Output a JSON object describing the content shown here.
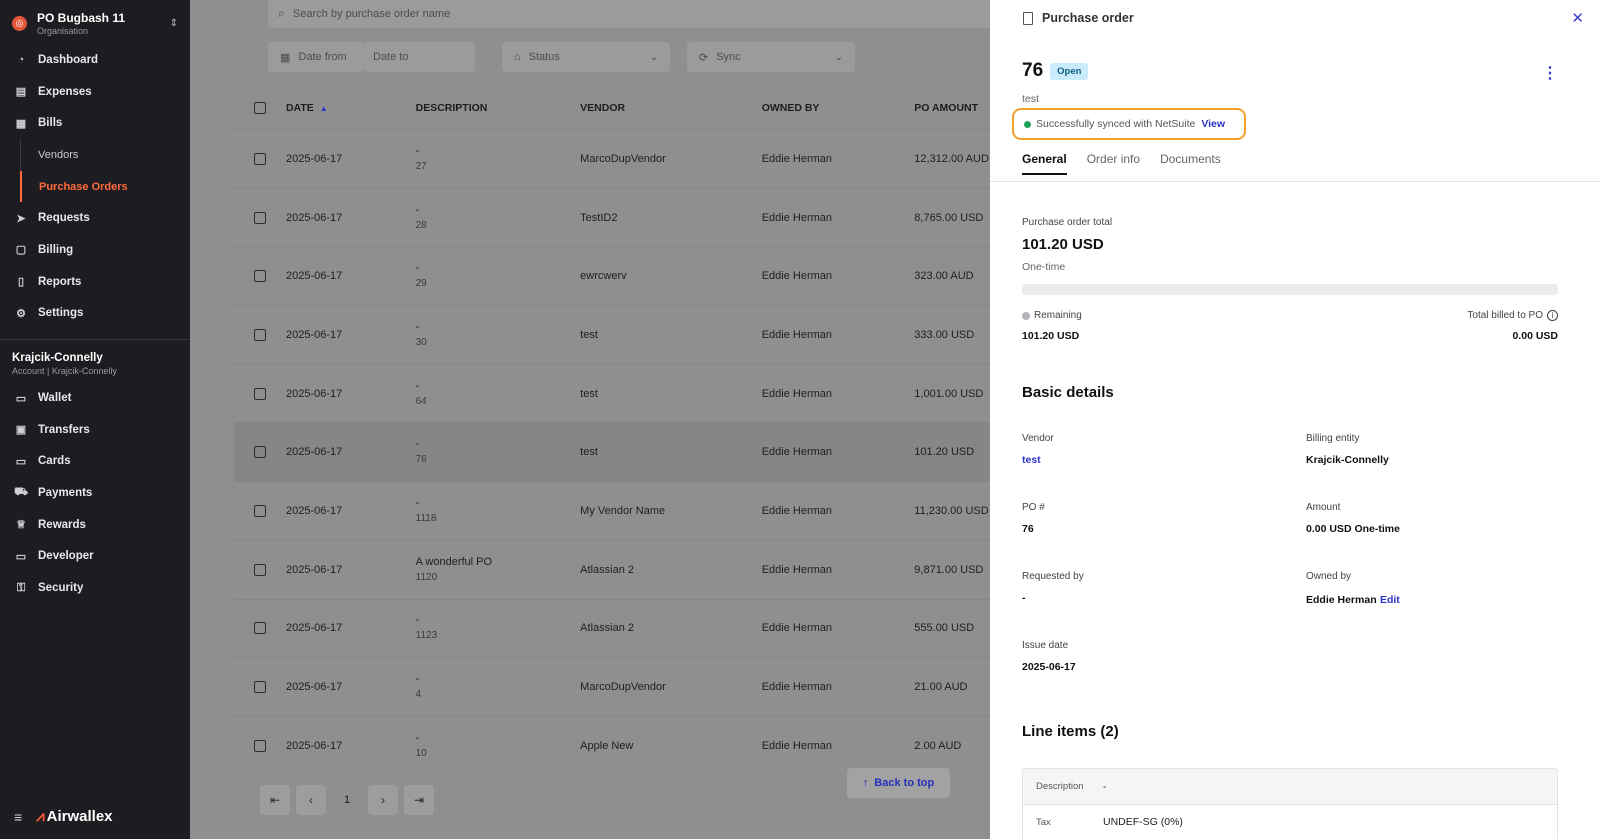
{
  "sidebar": {
    "org": {
      "name": "PO Bugbash 11",
      "sub": "Organisation"
    },
    "items": [
      {
        "label": "Dashboard",
        "icon": "dashboard-icon",
        "glyph": "◔"
      },
      {
        "label": "Expenses",
        "icon": "receipt-icon",
        "glyph": "▤"
      },
      {
        "label": "Bills",
        "icon": "bills-icon",
        "glyph": "▦"
      }
    ],
    "subitems": [
      {
        "label": "Vendors"
      },
      {
        "label": "Purchase Orders",
        "active": true
      }
    ],
    "items2": [
      {
        "label": "Requests",
        "icon": "send-icon",
        "glyph": "➤"
      },
      {
        "label": "Billing",
        "icon": "billing-icon",
        "glyph": "▢"
      },
      {
        "label": "Reports",
        "icon": "report-icon",
        "glyph": "▯"
      },
      {
        "label": "Settings",
        "icon": "gear-icon",
        "glyph": "⚙"
      }
    ],
    "account": {
      "name": "Krajcik-Connelly",
      "sub": "Account | Krajcik-Connelly"
    },
    "items3": [
      {
        "label": "Wallet",
        "icon": "wallet-icon",
        "glyph": "▭"
      },
      {
        "label": "Transfers",
        "icon": "transfer-icon",
        "glyph": "▣"
      },
      {
        "label": "Cards",
        "icon": "card-icon",
        "glyph": "▭"
      },
      {
        "label": "Payments",
        "icon": "cart-icon",
        "glyph": "⛟"
      },
      {
        "label": "Rewards",
        "icon": "trophy-icon",
        "glyph": "♕"
      },
      {
        "label": "Developer",
        "icon": "monitor-icon",
        "glyph": "▭"
      },
      {
        "label": "Security",
        "icon": "lock-icon",
        "glyph": "⚿"
      }
    ],
    "brand": "Airwallex"
  },
  "list": {
    "search_placeholder": "Search by purchase order name",
    "filters": {
      "date_from": "Date from",
      "date_to": "Date to",
      "status": "Status",
      "sync": "Sync"
    },
    "columns": {
      "date": "DATE",
      "description": "DESCRIPTION",
      "vendor": "VENDOR",
      "owned_by": "OWNED BY",
      "amount": "PO AMOUNT"
    },
    "rows": [
      {
        "date": "2025-06-17",
        "desc": "-",
        "ref": "27",
        "vendor": "MarcoDupVendor",
        "owner": "Eddie Herman",
        "amount": "12,312.00 AUD"
      },
      {
        "date": "2025-06-17",
        "desc": "-",
        "ref": "28",
        "vendor": "TestID2",
        "owner": "Eddie Herman",
        "amount": "8,765.00 USD"
      },
      {
        "date": "2025-06-17",
        "desc": "-",
        "ref": "29",
        "vendor": "ewrcwerv",
        "owner": "Eddie Herman",
        "amount": "323.00 AUD"
      },
      {
        "date": "2025-06-17",
        "desc": "-",
        "ref": "30",
        "vendor": "test",
        "owner": "Eddie Herman",
        "amount": "333.00 USD"
      },
      {
        "date": "2025-06-17",
        "desc": "-",
        "ref": "64",
        "vendor": "test",
        "owner": "Eddie Herman",
        "amount": "1,001.00 USD"
      },
      {
        "date": "2025-06-17",
        "desc": "-",
        "ref": "76",
        "vendor": "test",
        "owner": "Eddie Herman",
        "amount": "101.20 USD",
        "highlight": true
      },
      {
        "date": "2025-06-17",
        "desc": "-",
        "ref": "1118",
        "vendor": "My Vendor Name",
        "owner": "Eddie Herman",
        "amount": "11,230.00 USD"
      },
      {
        "date": "2025-06-17",
        "desc": "A wonderful PO",
        "ref": "1120",
        "vendor": "Atlassian 2",
        "owner": "Eddie Herman",
        "amount": "9,871.00 USD"
      },
      {
        "date": "2025-06-17",
        "desc": "-",
        "ref": "1123",
        "vendor": "Atlassian 2",
        "owner": "Eddie Herman",
        "amount": "555.00 USD"
      },
      {
        "date": "2025-06-17",
        "desc": "-",
        "ref": "4",
        "vendor": "MarcoDupVendor",
        "owner": "Eddie Herman",
        "amount": "21.00 AUD"
      },
      {
        "date": "2025-06-17",
        "desc": "-",
        "ref": "10",
        "vendor": "Apple New",
        "owner": "Eddie Herman",
        "amount": "2.00 AUD"
      }
    ],
    "page": "1",
    "back_to_top": "Back to top"
  },
  "panel": {
    "title": "Purchase order",
    "po_number": "76",
    "status": "Open",
    "subtitle": "test",
    "sync_text": "Successfully synced with NetSuite",
    "sync_link": "View",
    "tabs": [
      "General",
      "Order info",
      "Documents"
    ],
    "total_label": "Purchase order total",
    "total_value": "101.20 USD",
    "frequency": "One-time",
    "billed_fraction": 0,
    "remaining_label": "Remaining",
    "remaining_value": "101.20 USD",
    "billed_label": "Total billed to PO",
    "billed_value": "0.00 USD",
    "basic_details": "Basic details",
    "fields": {
      "vendor_label": "Vendor",
      "vendor_value": "test",
      "billing_label": "Billing entity",
      "billing_value": "Krajcik-Connelly",
      "po_label": "PO #",
      "po_value": "76",
      "amount_label": "Amount",
      "amount_value": "0.00 USD One-time",
      "requested_label": "Requested by",
      "requested_value": "-",
      "owned_label": "Owned by",
      "owned_value": "Eddie Herman",
      "owned_edit": "Edit",
      "issue_label": "Issue date",
      "issue_value": "2025-06-17"
    },
    "line_items_title": "Line items (2)",
    "line_items": [
      {
        "k": "Description",
        "v": "-"
      },
      {
        "k": "Tax",
        "v": "UNDEF-SG (0%)"
      }
    ]
  }
}
